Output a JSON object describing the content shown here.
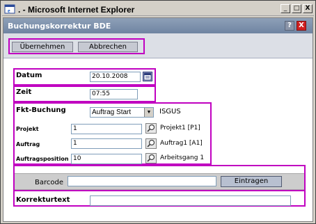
{
  "window": {
    "title": ". - Microsoft Internet Explorer",
    "minimize_glyph": "_",
    "maximize_glyph": "□",
    "close_glyph": "X"
  },
  "app": {
    "title": "Buchungskorrektur BDE",
    "help_label": "?",
    "close_label": "X"
  },
  "toolbar": {
    "accept_label": "Übernehmen",
    "cancel_label": "Abbrechen"
  },
  "form": {
    "datum": {
      "label": "Datum",
      "value": "20.10.2008"
    },
    "zeit": {
      "label": "Zeit",
      "value": "07:55"
    },
    "fkt_buchung": {
      "label": "Fkt-Buchung",
      "selected": "Auftrag Start",
      "suffix": "ISGUS"
    },
    "projekt": {
      "label": "Projekt",
      "value": "1",
      "result": "Projekt1 [P1]"
    },
    "auftrag": {
      "label": "Auftrag",
      "value": "1",
      "result": "Auftrag1 [A1]"
    },
    "auftragsposition": {
      "label": "Auftragsposition",
      "value": "10",
      "result": "Arbeitsgang 1"
    },
    "barcode": {
      "label": "Barcode",
      "value": "",
      "button_label": "Eintragen"
    },
    "korrekturtext": {
      "label": "Korrekturtext",
      "value": ""
    }
  },
  "colors": {
    "highlight_frame": "#c000c0",
    "app_header": "#7a8eab",
    "toolbar_bg": "#dcdfe6"
  },
  "icons": {
    "ie": "ie-icon",
    "calendar": "calendar-icon",
    "search": "magnifier-icon",
    "dropdown": "chevron-down-icon"
  }
}
